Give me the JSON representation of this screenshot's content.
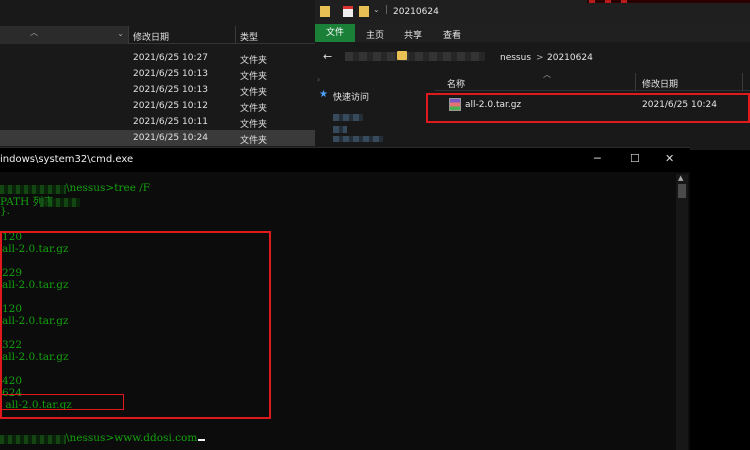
{
  "left_explorer": {
    "columns": {
      "date": "修改日期",
      "type": "类型"
    },
    "rows": [
      {
        "date": "2021/6/25 10:27",
        "type": "文件夹"
      },
      {
        "date": "2021/6/25 10:13",
        "type": "文件夹"
      },
      {
        "date": "2021/6/25 10:13",
        "type": "文件夹"
      },
      {
        "date": "2021/6/25 10:12",
        "type": "文件夹"
      },
      {
        "date": "2021/6/25 10:11",
        "type": "文件夹"
      },
      {
        "date": "2021/6/25 10:24",
        "type": "文件夹",
        "selected": true
      }
    ]
  },
  "right_explorer": {
    "window_title": "20210624",
    "ribbon_tabs": [
      "文件",
      "主页",
      "共享",
      "查看"
    ],
    "breadcrumb": [
      "nessus",
      ">",
      "20210624"
    ],
    "quick_access": "快速访问",
    "columns": {
      "name": "名称",
      "date": "修改日期"
    },
    "file": {
      "name": "all-2.0.tar.gz",
      "date": "2021/6/25 10:24",
      "icon": "rar-archive-icon"
    },
    "highlight_color": "#e0191d"
  },
  "cmd": {
    "title": "indows\\system32\\cmd.exe",
    "controls": {
      "minimize": "─",
      "maximize": "☐",
      "close": "✕"
    },
    "text_color": "#13a10e",
    "lines": {
      "l1": "\\nessus>tree /F",
      "l2": "PATH 列表",
      "l3": "}.",
      "l4": "120",
      "l5": "all-2.0.tar.gz",
      "l6": "229",
      "l7": "all-2.0.tar.gz",
      "l8": "120",
      "l9": "all-2.0.tar.gz",
      "l10": "322",
      "l11": "all-2.0.tar.gz",
      "l12": "420",
      "l13": "624",
      "l14": " all-2.0.tar.gz",
      "l15": "\\nessus>www.ddosi.com"
    }
  }
}
